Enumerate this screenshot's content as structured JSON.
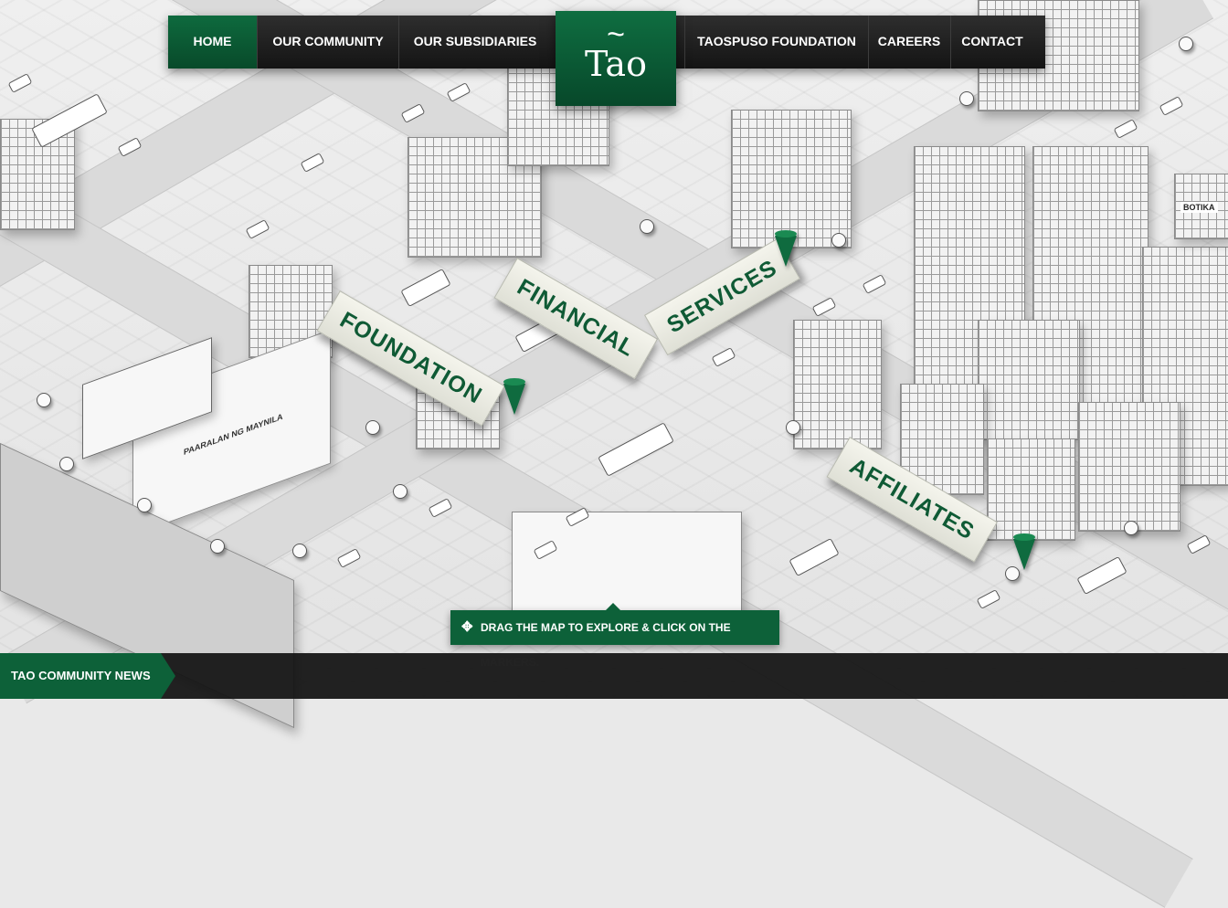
{
  "nav": {
    "items": [
      "HOME",
      "OUR COMMUNITY",
      "OUR SUBSIDIARIES",
      "TAOSPUSO FOUNDATION",
      "CAREERS",
      "CONTACT"
    ],
    "active": "HOME",
    "logo_text": "Tao",
    "logo_accent": "~"
  },
  "map": {
    "districts": [
      "FINANCIAL",
      "SERVICES",
      "FOUNDATION",
      "AFFILIATES"
    ],
    "school_sign": "PAARALAN NG MAYNILA",
    "store_sign": "BOTIKA"
  },
  "hint": {
    "icon": "move-arrows-icon",
    "text": "DRAG THE MAP TO EXPLORE & CLICK ON THE MARKERS."
  },
  "footer": {
    "news_label": "TAO COMMUNITY NEWS"
  },
  "colors": {
    "brand_green": "#0d6139",
    "nav_dark": "#1d1d1d",
    "banner_text": "#0f5a35",
    "map_bg": "#e9e9e9"
  }
}
